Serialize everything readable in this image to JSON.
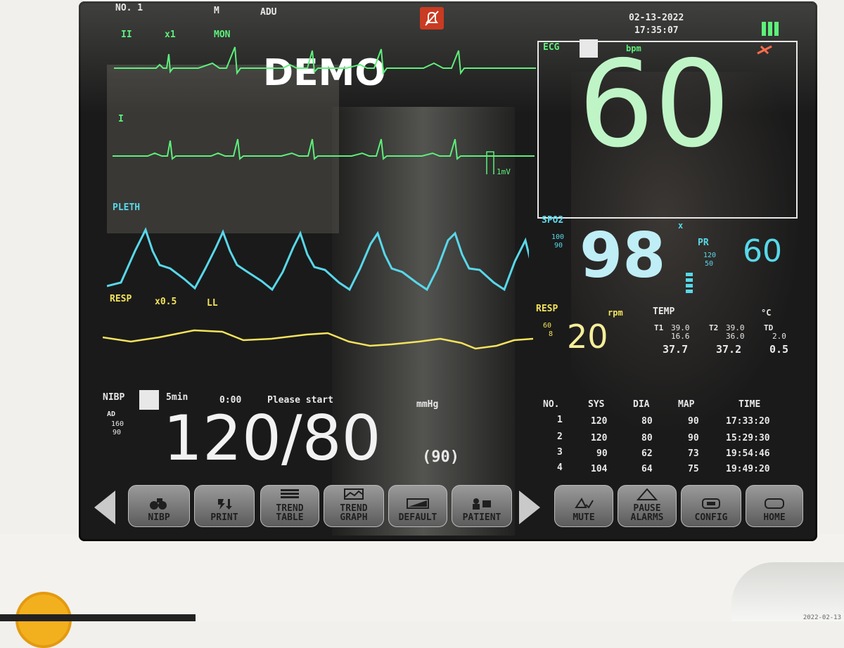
{
  "header": {
    "bed_label": "NO. 1",
    "flag": "M",
    "patient_type": "ADU",
    "date": "02-13-2022",
    "time": "17:35:07",
    "alarm_silenced_icon": "bell-mute-icon",
    "battery_icon": "battery-icon"
  },
  "ecg": {
    "lead1": "II",
    "gain": "x1",
    "mode": "MON",
    "demo": "DEMO",
    "lead2": "I",
    "scale": "1mV",
    "label": "ECG",
    "unit": "bpm",
    "hr": "60"
  },
  "pleth": {
    "label": "PLETH"
  },
  "resp_wave": {
    "label": "RESP",
    "gain": "x0.5",
    "lead": "LL"
  },
  "spo2": {
    "label": "SPO2",
    "high": "100",
    "low": "90",
    "value": "98",
    "pr_label": "PR",
    "pr_high": "120",
    "pr_low": "50",
    "pr_value": "60"
  },
  "resp": {
    "label": "RESP",
    "unit": "rpm",
    "high": "60",
    "low": "8",
    "value": "20"
  },
  "temp": {
    "label": "TEMP",
    "unit": "°C",
    "t1_label": "T1",
    "t1_high": "39.0",
    "t1_low": "16.6",
    "t1_value": "37.7",
    "t2_label": "T2",
    "t2_high": "39.0",
    "t2_low": "36.0",
    "t2_value": "37.2",
    "td_label": "TD",
    "td_limit": "2.0",
    "td_value": "0.5"
  },
  "nibp": {
    "label": "NIBP",
    "interval": "5min",
    "timer": "0:00",
    "prompt": "Please start",
    "unit": "mmHg",
    "mode": "AD",
    "high": "160",
    "low": "90",
    "value": "120/80",
    "map": "(90)"
  },
  "nibp_list": {
    "headers": [
      "NO.",
      "SYS",
      "DIA",
      "MAP",
      "TIME"
    ],
    "rows": [
      [
        "1",
        "120",
        "80",
        "90",
        "17:33:20"
      ],
      [
        "2",
        "120",
        "80",
        "90",
        "15:29:30"
      ],
      [
        "3",
        "90",
        "62",
        "73",
        "19:54:46"
      ],
      [
        "4",
        "104",
        "64",
        "75",
        "19:49:20"
      ]
    ]
  },
  "softkeys": {
    "nibp": "NIBP",
    "print": "PRINT",
    "trend_table_1": "TREND",
    "trend_table_2": "TABLE",
    "trend_graph_1": "TREND",
    "trend_graph_2": "GRAPH",
    "default": "DEFAULT",
    "patient": "PATIENT",
    "mute": "MUTE",
    "pause_1": "PAUSE",
    "pause_2": "ALARMS",
    "config": "CONFIG",
    "home": "HOME"
  },
  "device_stamp": "2022-02-13"
}
